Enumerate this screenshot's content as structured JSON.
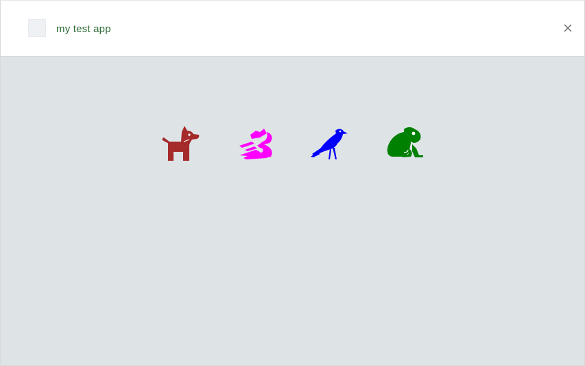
{
  "window": {
    "title": "my test app",
    "app_icon": "app-placeholder-icon",
    "close_icon": "close-icon"
  },
  "animals": [
    {
      "name": "dog",
      "icon": "dog-icon",
      "color": "#a52a2a"
    },
    {
      "name": "dragon",
      "icon": "dragon-icon",
      "color": "#ff00ff"
    },
    {
      "name": "crow",
      "icon": "crow-icon",
      "color": "#0000ff"
    },
    {
      "name": "frog",
      "icon": "frog-icon",
      "color": "#008000"
    }
  ],
  "colors": {
    "background": "#dee3e6",
    "titlebar": "#ffffff",
    "title_text": "#2e6b35"
  }
}
